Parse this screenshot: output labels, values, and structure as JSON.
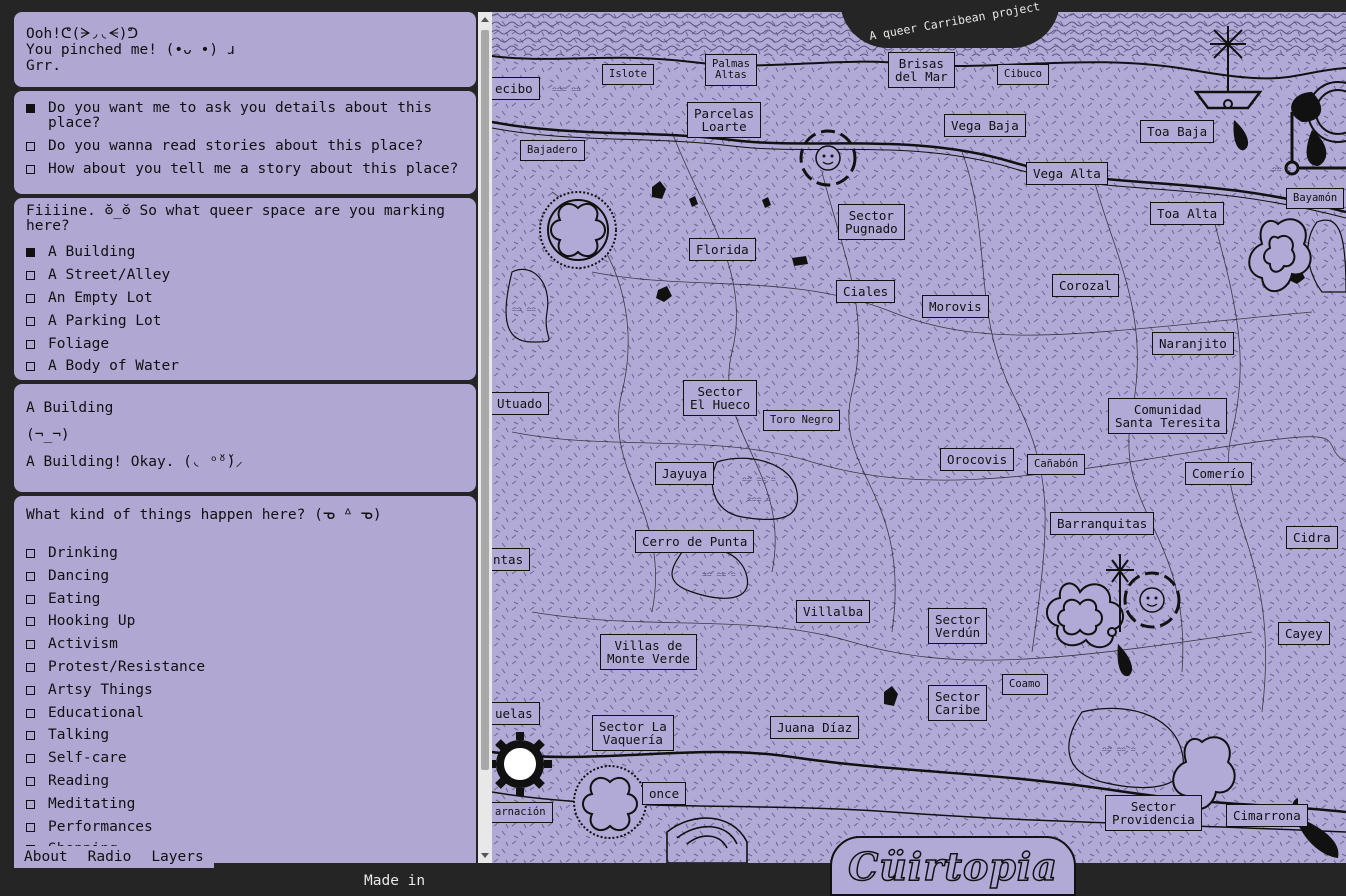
{
  "panel": {
    "greeting": [
      "Ooh!ᕦ(ᗒ◞◟ᗕ)ᕤ",
      "You pinched me! (•ᴗ •) ɹ",
      "Grr."
    ],
    "q1_options": [
      {
        "label": "Do you want me to ask you details about this\nplace?",
        "checked": true
      },
      {
        "label": "Do you wanna read stories about this place?",
        "checked": false
      },
      {
        "label": "How about you tell me a story about this place?",
        "checked": false
      }
    ],
    "q2_prompt": "Fiiiine. ʘ̆_ʘ̆ So what queer space are you marking\nhere?",
    "q2_options": [
      {
        "label": "A Building",
        "checked": true
      },
      {
        "label": "A Street/Alley",
        "checked": false
      },
      {
        "label": "An Empty Lot",
        "checked": false
      },
      {
        "label": "A Parking Lot",
        "checked": false
      },
      {
        "label": "Foliage",
        "checked": false
      },
      {
        "label": "A Body of Water",
        "checked": false
      }
    ],
    "selection": "A Building",
    "face": "(¬_¬)",
    "reply": "A Building! Okay. (◟ ᵒ̌ᵒ̌)⸝",
    "q3_prompt": "What kind of things happen here? (ᓀ ᐞ ᓀ)",
    "q3_options": [
      "Drinking",
      "Dancing",
      "Eating",
      "Hooking Up",
      "Activism",
      "Protest/Resistance",
      "Artsy Things",
      "Educational",
      "Talking",
      "Self-care",
      "Reading",
      "Meditating",
      "Performances",
      "Shopping"
    ]
  },
  "tabs": [
    "About",
    "Radio",
    "Layers"
  ],
  "footer": {
    "made_in": "Made in",
    "brand": "Cüirtopia"
  },
  "map": {
    "tagline": "A queer Carribean project",
    "places": [
      {
        "name": "ecibo",
        "sm": false
      },
      {
        "name": "Islote",
        "sm": true
      },
      {
        "name": "Palmas\nAltas",
        "sm": true
      },
      {
        "name": "Brisas\ndel Mar",
        "sm": false
      },
      {
        "name": "Cibuco",
        "sm": true
      },
      {
        "name": "Parcelas\nLoarte",
        "sm": false
      },
      {
        "name": "Vega Baja",
        "sm": false
      },
      {
        "name": "Toa Baja",
        "sm": false
      },
      {
        "name": "Bajadero",
        "sm": true
      },
      {
        "name": "Vega Alta",
        "sm": false
      },
      {
        "name": "Bayamón",
        "sm": true
      },
      {
        "name": "Toa Alta",
        "sm": false
      },
      {
        "name": "Sector\nPugnado",
        "sm": false
      },
      {
        "name": "Florida",
        "sm": false
      },
      {
        "name": "Ciales",
        "sm": false
      },
      {
        "name": "Morovis",
        "sm": false
      },
      {
        "name": "Corozal",
        "sm": false
      },
      {
        "name": "Naranjito",
        "sm": false
      },
      {
        "name": "Utuado",
        "sm": false
      },
      {
        "name": "Sector\nEl Hueco",
        "sm": false
      },
      {
        "name": "Toro Negro",
        "sm": true
      },
      {
        "name": "Comunidad\nSanta Teresita",
        "sm": false
      },
      {
        "name": "Jayuya",
        "sm": false
      },
      {
        "name": "Orocovis",
        "sm": false
      },
      {
        "name": "Cañabón",
        "sm": true
      },
      {
        "name": "Comerío",
        "sm": false
      },
      {
        "name": "Barranquitas",
        "sm": false
      },
      {
        "name": "ntas",
        "sm": false
      },
      {
        "name": "Cerro de Punta",
        "sm": false
      },
      {
        "name": "Cidra",
        "sm": false
      },
      {
        "name": "Villalba",
        "sm": false
      },
      {
        "name": "Sector\nVerdún",
        "sm": false
      },
      {
        "name": "Cayey",
        "sm": false
      },
      {
        "name": "Villas de\nMonte Verde",
        "sm": false
      },
      {
        "name": "Coamo",
        "sm": true
      },
      {
        "name": "uelas",
        "sm": false
      },
      {
        "name": "Sector\nCaribe",
        "sm": false
      },
      {
        "name": "Sector La\nVaquería",
        "sm": false
      },
      {
        "name": "Juana Díaz",
        "sm": false
      },
      {
        "name": "once",
        "sm": false
      },
      {
        "name": "arnación",
        "sm": true
      },
      {
        "name": "Sector\nProvidencia",
        "sm": false
      },
      {
        "name": "Cimarrona",
        "sm": false
      }
    ]
  }
}
